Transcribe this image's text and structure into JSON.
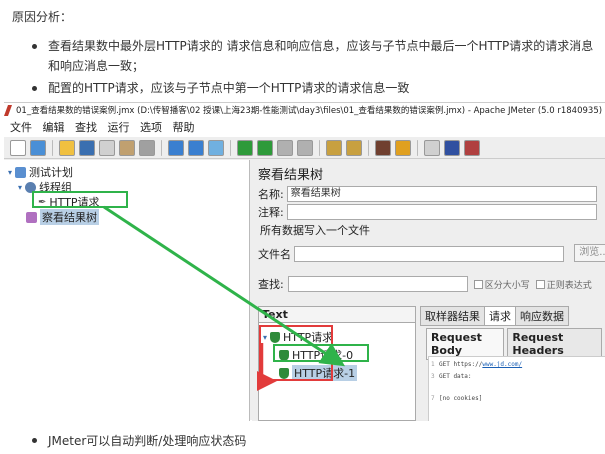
{
  "doc": {
    "heading": "原因分析：",
    "bullets": [
      "查看结果数中最外层HTTP请求的 请求信息和响应信息，应该与子节点中最后一个HTTP请求的请求消息和响应消息一致；",
      "配置的HTTP请求，应该与子节点中第一个HTTP请求的请求信息一致"
    ],
    "footer_bullet": "JMeter可以自动判断/处理响应状态码"
  },
  "app": {
    "title": "01_查看结果数的错误案例.jmx (D:\\传智播客\\02 授课\\上海23期-性能测试\\day3\\files\\01_查看结果数的错误案例.jmx) - Apache JMeter (5.0 r1840935)",
    "menu": [
      "文件",
      "编辑",
      "查找",
      "运行",
      "选项",
      "帮助"
    ],
    "toolbar_icons": [
      "new-icon",
      "templates-icon",
      "open-icon",
      "save-icon",
      "cut-icon",
      "copy-icon",
      "paste-icon",
      "expand-icon",
      "collapse-icon",
      "toggle-icon",
      "start-icon",
      "start-no-pause-icon",
      "stop-icon",
      "shutdown-icon",
      "clear-icon",
      "clear-all-icon",
      "search-icon",
      "reset-search-icon",
      "function-helper-icon",
      "help-icon",
      "remote-icon"
    ],
    "toolbar_colors": [
      "#ffffff",
      "#4a8fd6",
      "#f0c040",
      "#3a6fb0",
      "#d0d0d0",
      "#c0a070",
      "#a0a0a0",
      "#3a7fd0",
      "#3a7fd0",
      "#70b0e0",
      "#2e9a3a",
      "#2e9a3a",
      "#b0b0b0",
      "#b0b0b0",
      "#c8a040",
      "#c8a040",
      "#704030",
      "#e0a020",
      "#d0d0d0",
      "#3050a0",
      "#b04040"
    ],
    "tree": {
      "plan": "测试计划",
      "thread_group": "线程组",
      "http_request": "HTTP请求",
      "results_tree": "察看结果树"
    },
    "panel": {
      "title": "察看结果树",
      "name_label": "名称:",
      "name_value": "察看结果树",
      "comment_label": "注释:",
      "write_all_label": "所有数据写入一个文件",
      "filename_label": "文件名",
      "browse_label": "浏览...",
      "search_label": "查找:",
      "case_sensitive_label": "区分大小写",
      "regex_label": "正则表达式"
    },
    "results": {
      "header": "Text",
      "parent": "HTTP请求",
      "child0": "HTTP请求-0",
      "child1": "HTTP请求-1"
    },
    "tabs": [
      "取样器结果",
      "请求",
      "响应数据"
    ],
    "subtabs": [
      "Request Body",
      "Request Headers"
    ],
    "request_body": {
      "line1_prefix": "GET https://",
      "line1_link": "www.jd.com/",
      "line2": "GET data:",
      "line3": "[no cookies]"
    }
  }
}
